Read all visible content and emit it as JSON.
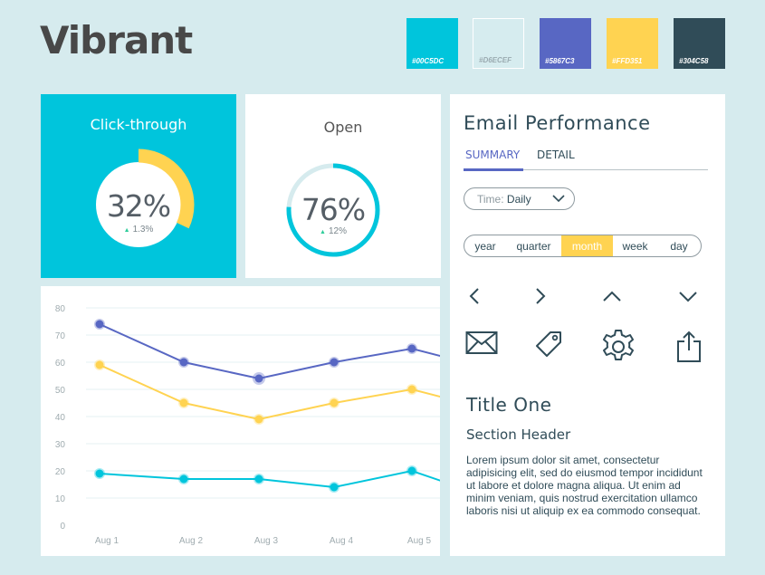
{
  "brand": {
    "title": "Vibrant"
  },
  "palette": [
    {
      "hex": "#00C5DC",
      "label": "#00C5DC"
    },
    {
      "hex": "#D6ECEF",
      "label": "#D6ECEF"
    },
    {
      "hex": "#5867C3",
      "label": "#5867C3"
    },
    {
      "hex": "#FFD351",
      "label": "#FFD351"
    },
    {
      "hex": "#304C58",
      "label": "#304C58"
    }
  ],
  "click_through": {
    "title": "Click-through",
    "value": "32%",
    "delta": "1.3%",
    "percent": 32
  },
  "open": {
    "title": "Open",
    "value": "76%",
    "delta": "12%",
    "percent": 76
  },
  "performance": {
    "title": "Email Performance",
    "tabs": [
      "SUMMARY",
      "DETAIL"
    ],
    "active_tab": "SUMMARY",
    "time_select": {
      "label": "Time:",
      "value": "Daily"
    },
    "segments": [
      "year",
      "quarter",
      "month",
      "week",
      "day"
    ],
    "active_segment": "month",
    "icons": [
      "chevron-left-icon",
      "chevron-right-icon",
      "chevron-up-icon",
      "chevron-down-icon",
      "mail-icon",
      "tag-icon",
      "gear-icon",
      "share-icon"
    ],
    "title_one": "Title One",
    "section_header": "Section Header",
    "body_text": "Lorem ipsum dolor sit amet, consectetur adipisicing elit, sed do eiusmod tempor incididunt ut labore et dolore magna aliqua. Ut enim ad minim veniam, quis nostrud exercitation ullamco laboris nisi ut aliquip ex ea commodo consequat."
  },
  "chart_data": {
    "type": "line",
    "categories": [
      "Aug 1",
      "Aug 2",
      "Aug 3",
      "Aug 4",
      "Aug 5"
    ],
    "yticks": [
      0,
      10,
      20,
      30,
      40,
      50,
      60,
      70,
      80
    ],
    "ylim": [
      0,
      80
    ],
    "grid": true,
    "series": [
      {
        "color": "#5867C3",
        "values": [
          74,
          60,
          54,
          60,
          65
        ],
        "tail": 62
      },
      {
        "color": "#FFD351",
        "values": [
          59,
          45,
          39,
          45,
          50
        ],
        "tail": 47
      },
      {
        "color": "#00C5DC",
        "values": [
          19,
          17,
          17,
          14,
          20
        ],
        "tail": 16
      }
    ]
  }
}
